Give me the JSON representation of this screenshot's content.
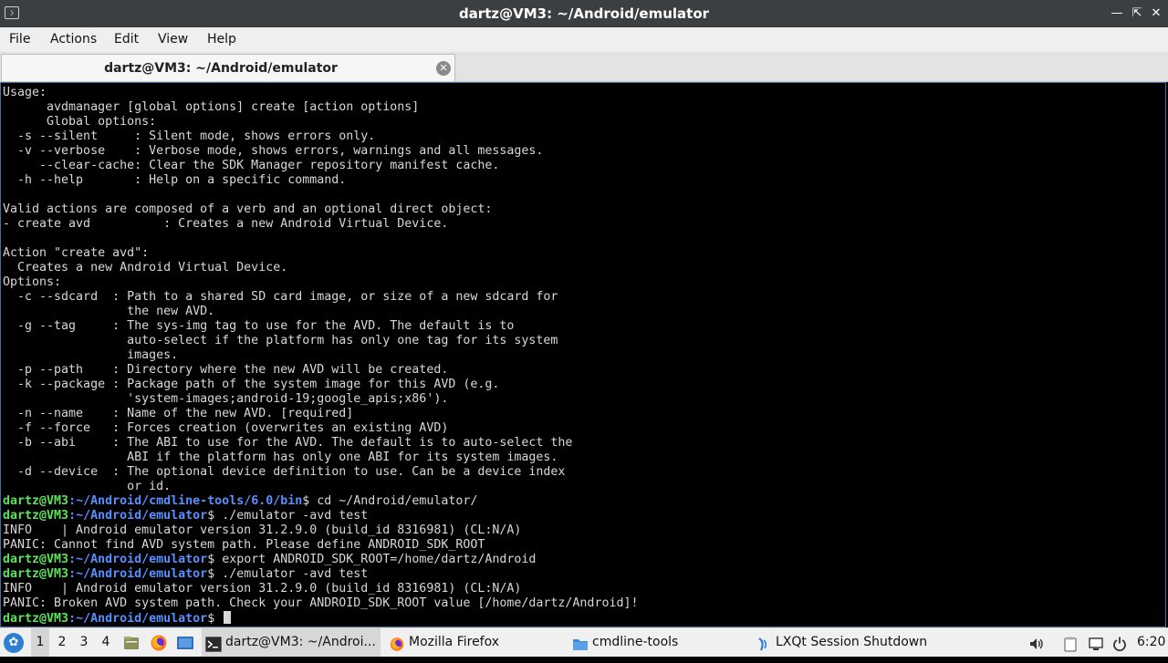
{
  "window": {
    "title": "dartz@VM3: ~/Android/emulator",
    "controls": [
      "minimize",
      "maximize",
      "close"
    ]
  },
  "menu": [
    "File",
    "Actions",
    "Edit",
    "View",
    "Help"
  ],
  "tab": {
    "label": "dartz@VM3: ~/Android/emulator",
    "close_icon": "close-icon"
  },
  "terminal": {
    "lines": [
      {
        "text": "Usage:"
      },
      {
        "text": "      avdmanager [global options] create [action options]"
      },
      {
        "text": "      Global options:"
      },
      {
        "text": "  -s --silent     : Silent mode, shows errors only."
      },
      {
        "text": "  -v --verbose    : Verbose mode, shows errors, warnings and all messages."
      },
      {
        "text": "     --clear-cache: Clear the SDK Manager repository manifest cache."
      },
      {
        "text": "  -h --help       : Help on a specific command."
      },
      {
        "text": ""
      },
      {
        "text": "Valid actions are composed of a verb and an optional direct object:"
      },
      {
        "text": "- create avd          : Creates a new Android Virtual Device."
      },
      {
        "text": ""
      },
      {
        "text": "Action \"create avd\":"
      },
      {
        "text": "  Creates a new Android Virtual Device."
      },
      {
        "text": "Options:"
      },
      {
        "text": "  -c --sdcard  : Path to a shared SD card image, or size of a new sdcard for"
      },
      {
        "text": "                 the new AVD."
      },
      {
        "text": "  -g --tag     : The sys-img tag to use for the AVD. The default is to"
      },
      {
        "text": "                 auto-select if the platform has only one tag for its system"
      },
      {
        "text": "                 images."
      },
      {
        "text": "  -p --path    : Directory where the new AVD will be created."
      },
      {
        "text": "  -k --package : Package path of the system image for this AVD (e.g."
      },
      {
        "text": "                 'system-images;android-19;google_apis;x86')."
      },
      {
        "text": "  -n --name    : Name of the new AVD. [required]"
      },
      {
        "text": "  -f --force   : Forces creation (overwrites an existing AVD)"
      },
      {
        "text": "  -b --abi     : The ABI to use for the AVD. The default is to auto-select the"
      },
      {
        "text": "                 ABI if the platform has only one ABI for its system images."
      },
      {
        "text": "  -d --device  : The optional device definition to use. Can be a device index"
      },
      {
        "text": "                 or id."
      },
      {
        "user": "dartz@VM3",
        "path": "~/Android/cmdline-tools/6.0/bin",
        "cmd": " cd ~/Android/emulator/"
      },
      {
        "user": "dartz@VM3",
        "path": "~/Android/emulator",
        "cmd": " ./emulator -avd test"
      },
      {
        "text": "INFO    | Android emulator version 31.2.9.0 (build_id 8316981) (CL:N/A)"
      },
      {
        "text": "PANIC: Cannot find AVD system path. Please define ANDROID_SDK_ROOT"
      },
      {
        "user": "dartz@VM3",
        "path": "~/Android/emulator",
        "cmd": " export ANDROID_SDK_ROOT=/home/dartz/Android"
      },
      {
        "user": "dartz@VM3",
        "path": "~/Android/emulator",
        "cmd": " ./emulator -avd test"
      },
      {
        "text": "INFO    | Android emulator version 31.2.9.0 (build_id 8316981) (CL:N/A)"
      },
      {
        "text": "PANIC: Broken AVD system path. Check your ANDROID_SDK_ROOT value [/home/dartz/Android]!"
      },
      {
        "user": "dartz@VM3",
        "path": "~/Android/emulator",
        "cmd": " ",
        "cursor": true
      }
    ]
  },
  "taskbar": {
    "start_icon": "lxqt-start-icon",
    "workspaces": [
      "1",
      "2",
      "3",
      "4"
    ],
    "active_workspace": "1",
    "quicklaunch": [
      "file-manager-icon",
      "firefox-icon",
      "desktop-icon"
    ],
    "tasks": [
      {
        "label": "dartz@VM3: ~/Androi...",
        "icon": "terminal-icon",
        "active": true
      },
      {
        "label": "Mozilla Firefox",
        "icon": "firefox-icon",
        "active": false
      },
      {
        "label": "cmdline-tools",
        "icon": "folder-icon",
        "active": false
      },
      {
        "label": "LXQt Session Shutdown",
        "icon": "lxqt-icon",
        "active": false
      }
    ],
    "tray": [
      "volume-icon",
      "clipboard-icon",
      "network-icon",
      "power-icon"
    ],
    "clock": "6:20"
  },
  "colors": {
    "prompt_user": "#5ce25c",
    "prompt_path": "#5a8fff",
    "terminal_bg": "#000000",
    "terminal_fg": "#d8d8d8",
    "titlebar_bg": "#3c3f41"
  }
}
